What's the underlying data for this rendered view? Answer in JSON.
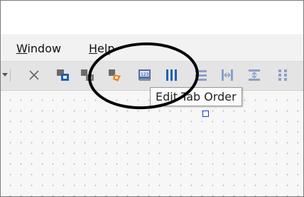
{
  "menu": {
    "window_label": "Window",
    "window_mnemonic": "W",
    "window_rest": "indow",
    "help_label": "Help",
    "help_mnemonic": "H",
    "help_rest": "elp"
  },
  "toolbar": {
    "items": [
      {
        "name": "dropdown-arrow-icon"
      },
      {
        "name": "close-icon"
      },
      {
        "name": "form-layout-icon"
      },
      {
        "name": "signals-slots-icon"
      },
      {
        "name": "buddy-edit-icon"
      },
      {
        "name": "tab-order-icon"
      },
      {
        "name": "layout-horizontal-icon"
      },
      {
        "name": "layout-vertical-icon"
      },
      {
        "name": "layout-hsplitter-icon"
      },
      {
        "name": "layout-vsplitter-icon"
      },
      {
        "name": "layout-grid-icon"
      }
    ]
  },
  "tooltip": {
    "text": "Edit Tab Order"
  },
  "colors": {
    "accent_blue": "#1f5fb8",
    "accent_orange": "#e8872a",
    "annotation_circle": "#000000"
  }
}
